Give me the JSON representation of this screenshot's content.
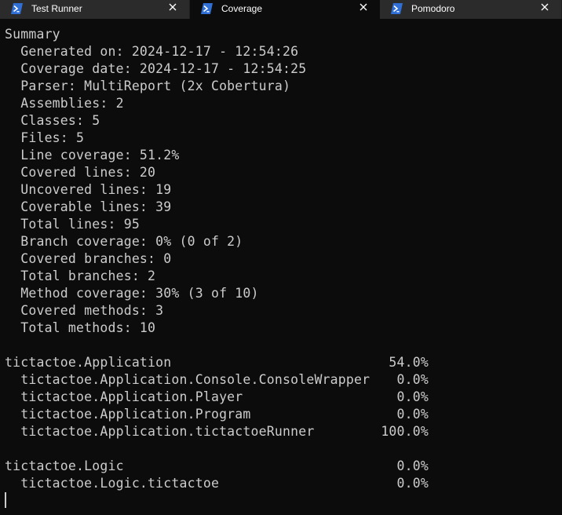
{
  "tabs": [
    {
      "label": "Test Runner",
      "active": false,
      "icon": "powershell-icon"
    },
    {
      "label": "Coverage",
      "active": true,
      "icon": "powershell-icon"
    },
    {
      "label": "Pomodoro",
      "active": false,
      "icon": "powershell-icon"
    }
  ],
  "colors": {
    "background": "#0c0c0c",
    "text": "#cccccc",
    "tabbar": "#202020",
    "inactive_tab": "#2b2b2b",
    "icon_blue": "#2f6fd6"
  },
  "summary": {
    "heading": "Summary",
    "lines": [
      "  Generated on: 2024-12-17 - 12:54:26",
      "  Coverage date: 2024-12-17 - 12:54:25",
      "  Parser: MultiReport (2x Cobertura)",
      "  Assemblies: 2",
      "  Classes: 5",
      "  Files: 5",
      "  Line coverage: 51.2%",
      "  Covered lines: 20",
      "  Uncovered lines: 19",
      "  Coverable lines: 39",
      "  Total lines: 95",
      "  Branch coverage: 0% (0 of 2)",
      "  Covered branches: 0",
      "  Total branches: 2",
      "  Method coverage: 30% (3 of 10)",
      "  Covered methods: 3",
      "  Total methods: 10"
    ]
  },
  "assemblies": [
    {
      "name": "tictactoe.Application",
      "coverage": "54.0%",
      "classes": [
        {
          "name": "  tictactoe.Application.Console.ConsoleWrapper",
          "coverage": "0.0%"
        },
        {
          "name": "  tictactoe.Application.Player",
          "coverage": "0.0%"
        },
        {
          "name": "  tictactoe.Application.Program",
          "coverage": "0.0%"
        },
        {
          "name": "  tictactoe.Application.tictactoeRunner",
          "coverage": "100.0%"
        }
      ]
    },
    {
      "name": "tictactoe.Logic",
      "coverage": "0.0%",
      "classes": [
        {
          "name": "  tictactoe.Logic.tictactoe",
          "coverage": "0.0%"
        }
      ]
    }
  ]
}
